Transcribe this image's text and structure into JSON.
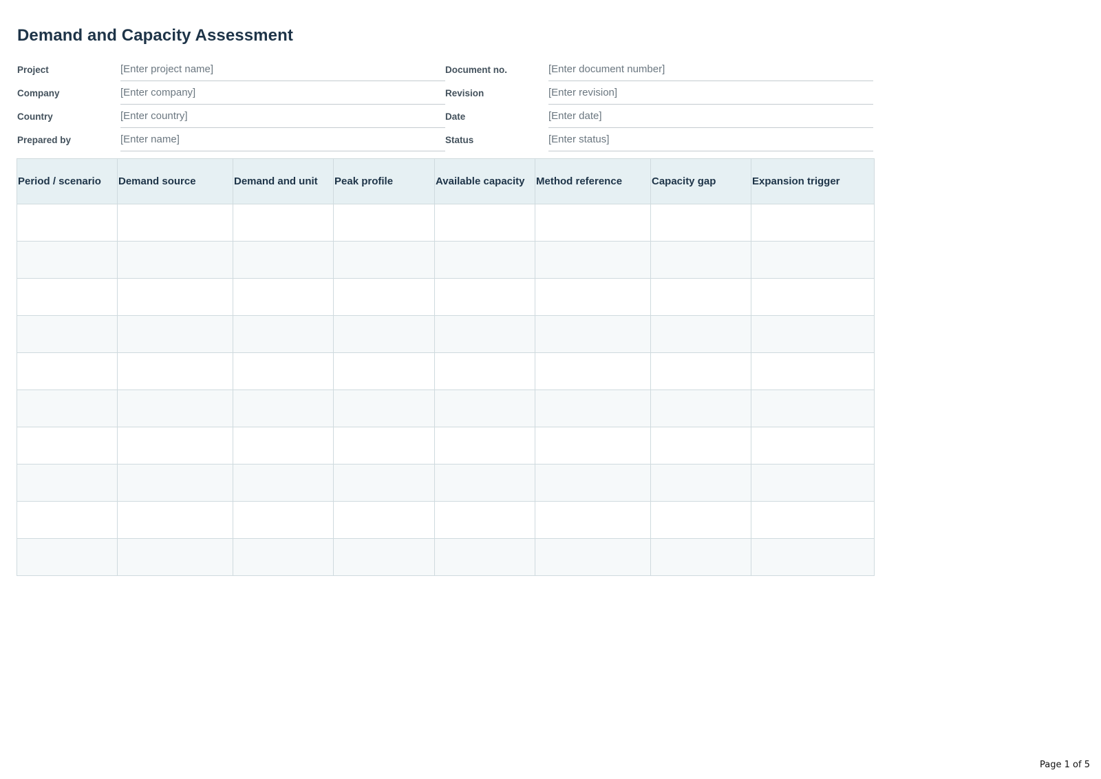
{
  "title": "Demand and Capacity Assessment",
  "meta": {
    "left": [
      {
        "label": "Project",
        "value": "[Enter project name]"
      },
      {
        "label": "Company",
        "value": "[Enter company]"
      },
      {
        "label": "Country",
        "value": "[Enter country]"
      },
      {
        "label": "Prepared by",
        "value": "[Enter name]"
      }
    ],
    "right": [
      {
        "label": "Document no.",
        "value": "[Enter document number]"
      },
      {
        "label": "Revision",
        "value": "[Enter revision]"
      },
      {
        "label": "Date",
        "value": "[Enter date]"
      },
      {
        "label": "Status",
        "value": "[Enter status]"
      }
    ]
  },
  "table": {
    "columns": [
      "Period / scenario",
      "Demand source",
      "Demand and unit",
      "Peak profile",
      "Available capacity",
      "Method reference",
      "Capacity gap",
      "Expansion trigger"
    ],
    "rows": [
      [
        "",
        "",
        "",
        "",
        "",
        "",
        "",
        ""
      ],
      [
        "",
        "",
        "",
        "",
        "",
        "",
        "",
        ""
      ],
      [
        "",
        "",
        "",
        "",
        "",
        "",
        "",
        ""
      ],
      [
        "",
        "",
        "",
        "",
        "",
        "",
        "",
        ""
      ],
      [
        "",
        "",
        "",
        "",
        "",
        "",
        "",
        ""
      ],
      [
        "",
        "",
        "",
        "",
        "",
        "",
        "",
        ""
      ],
      [
        "",
        "",
        "",
        "",
        "",
        "",
        "",
        ""
      ],
      [
        "",
        "",
        "",
        "",
        "",
        "",
        "",
        ""
      ],
      [
        "",
        "",
        "",
        "",
        "",
        "",
        "",
        ""
      ],
      [
        "",
        "",
        "",
        "",
        "",
        "",
        "",
        ""
      ]
    ]
  },
  "footer": {
    "page_label": "Page 1 of 5"
  }
}
